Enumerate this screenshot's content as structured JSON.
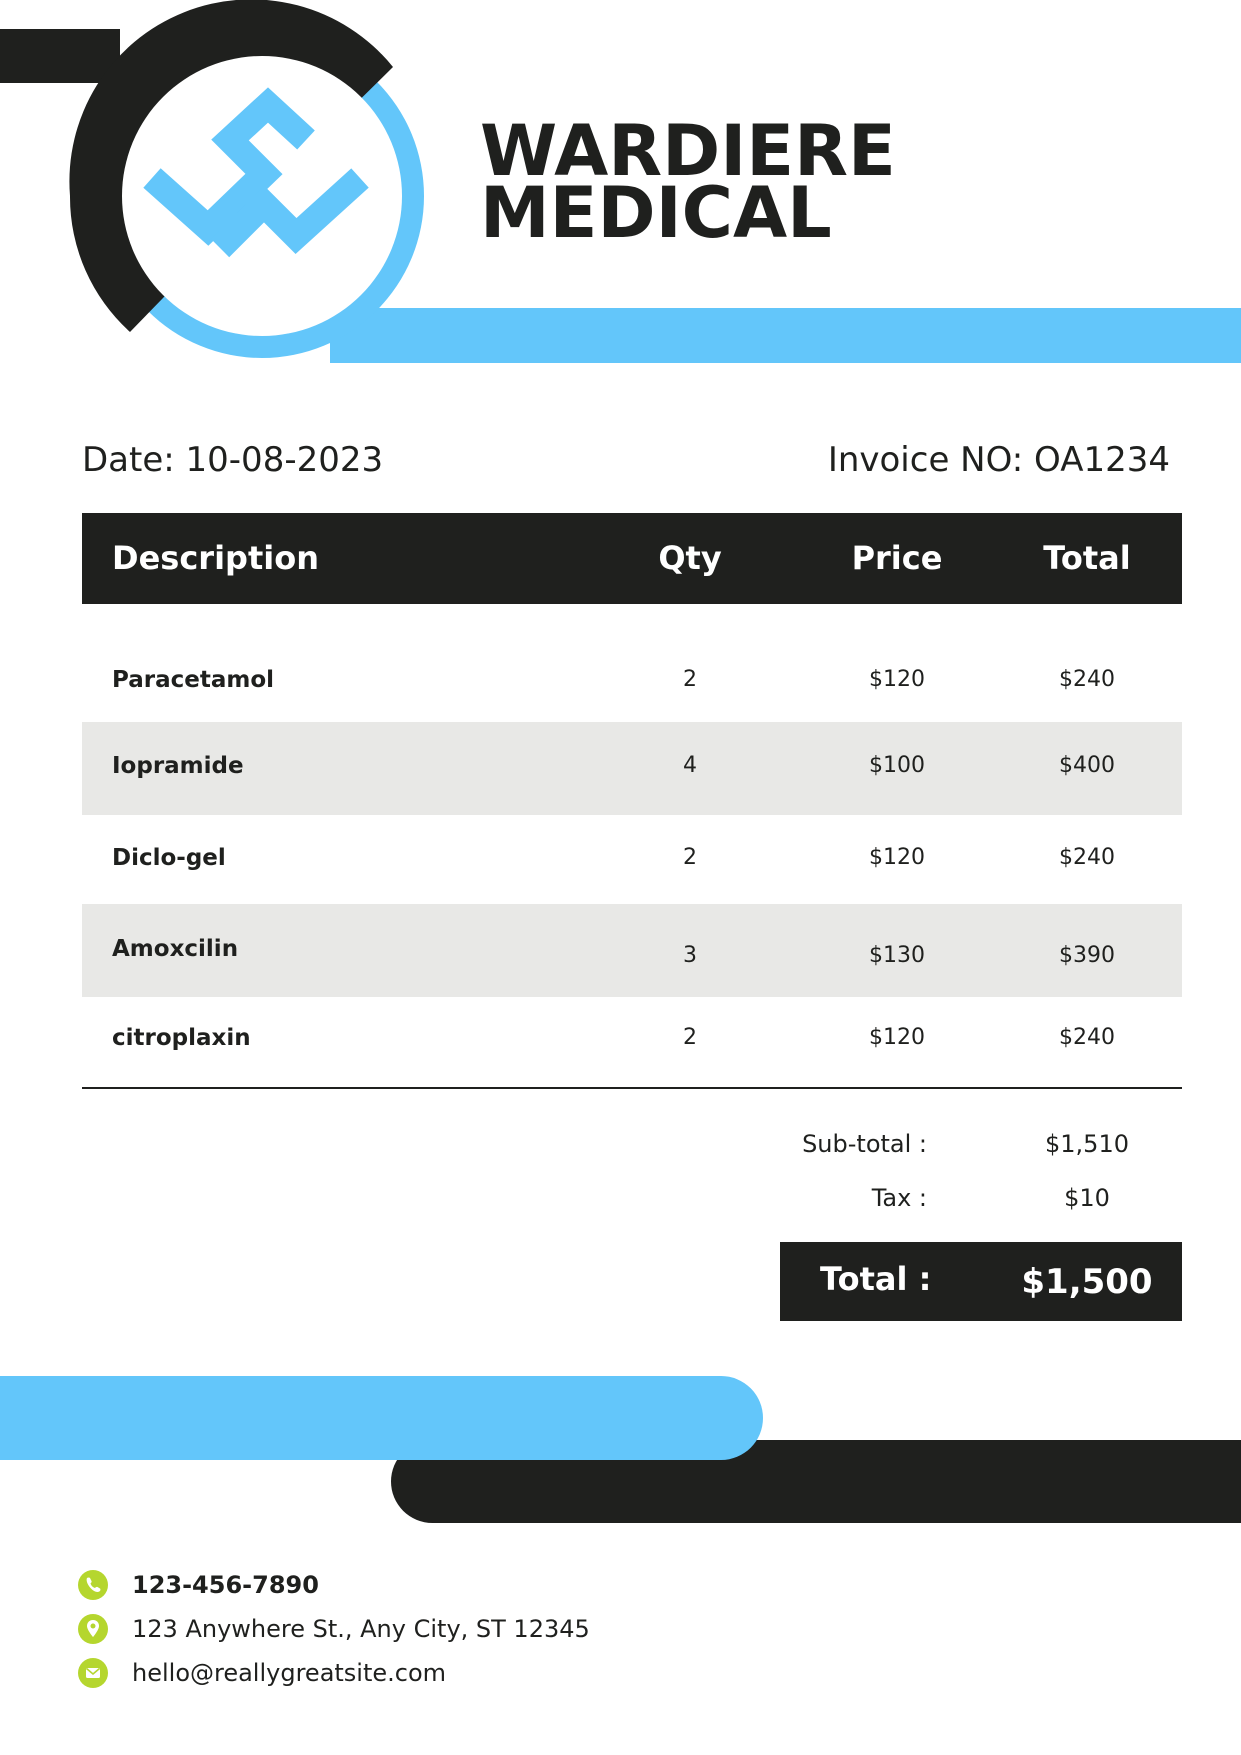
{
  "brand": {
    "line1": "WARDIERE",
    "line2": "MEDICAL"
  },
  "invoice": {
    "date": "Date: 10-08-2023",
    "number": "Invoice NO: OA1234"
  },
  "table": {
    "headers": {
      "description": "Description",
      "qty": "Qty",
      "price": "Price",
      "total": "Total"
    },
    "rows": [
      {
        "description": "Paracetamol",
        "qty": "2",
        "price": "$120",
        "total": "$240"
      },
      {
        "description": "Iopramide",
        "qty": "4",
        "price": "$100",
        "total": "$400"
      },
      {
        "description": "Diclo-gel",
        "qty": "2",
        "price": "$120",
        "total": "$240"
      },
      {
        "description": "Amoxcilin",
        "qty": "3",
        "price": "$130",
        "total": "$390"
      },
      {
        "description": "citroplaxin",
        "qty": "2",
        "price": "$120",
        "total": "$240"
      }
    ]
  },
  "summary": {
    "subtotal_label": "Sub-total :",
    "subtotal_value": "$1,510",
    "tax_label": "Tax :",
    "tax_value": "$10",
    "total_label": "Total :",
    "total_value": "$1,500"
  },
  "contact": {
    "phone": "123-456-7890",
    "address": "123 Anywhere St., Any City, ST 12345",
    "email": "hello@reallygreatsite.com"
  },
  "colors": {
    "dark": "#1f201e",
    "accent_blue": "#63c6fa",
    "icon_green": "#b5d62e",
    "row_shade": "#e8e8e6"
  },
  "icons": [
    "logo-icon",
    "phone-icon",
    "location-pin-icon",
    "mail-icon"
  ]
}
